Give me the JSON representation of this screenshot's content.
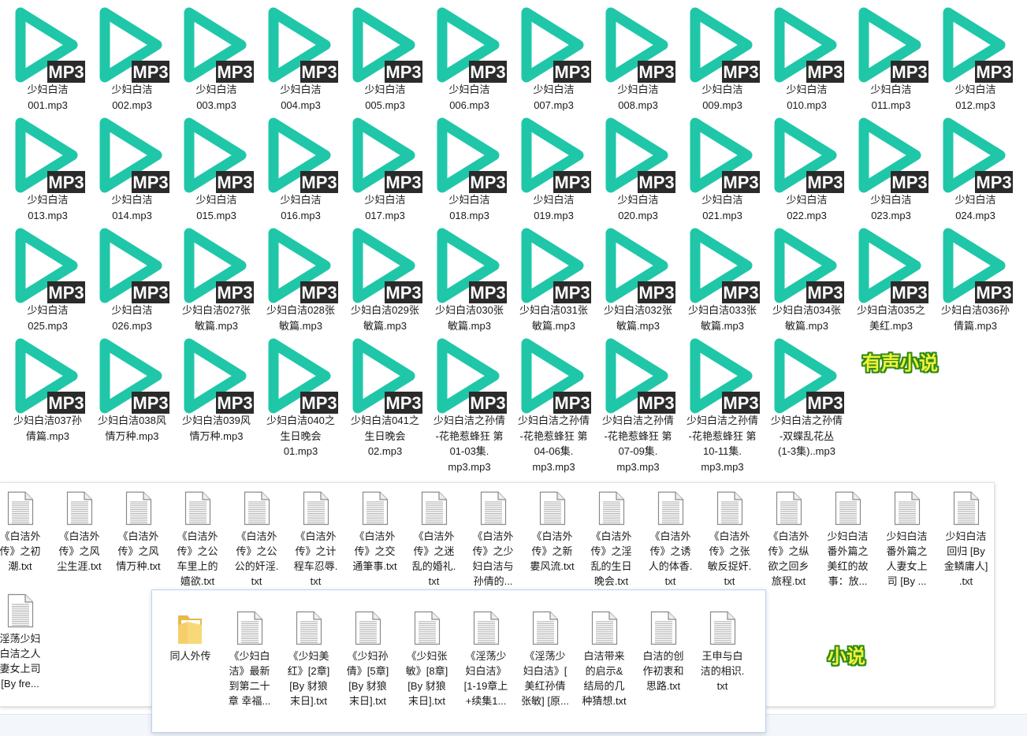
{
  "mp3_badge": "MP3",
  "colors": {
    "play": "#1fc7a8",
    "badge_bg": "#2b2b2b",
    "badge_fg": "#ffffff",
    "label_fill": "#f2f23a",
    "label_stroke": "#2f8a17"
  },
  "mp3_files": [
    "少妇白洁\n001.mp3",
    "少妇白洁\n002.mp3",
    "少妇白洁\n003.mp3",
    "少妇白洁\n004.mp3",
    "少妇白洁\n005.mp3",
    "少妇白洁\n006.mp3",
    "少妇白洁\n007.mp3",
    "少妇白洁\n008.mp3",
    "少妇白洁\n009.mp3",
    "少妇白洁\n010.mp3",
    "少妇白洁\n011.mp3",
    "少妇白洁\n012.mp3",
    "少妇白洁\n013.mp3",
    "少妇白洁\n014.mp3",
    "少妇白洁\n015.mp3",
    "少妇白洁\n016.mp3",
    "少妇白洁\n017.mp3",
    "少妇白洁\n018.mp3",
    "少妇白洁\n019.mp3",
    "少妇白洁\n020.mp3",
    "少妇白洁\n021.mp3",
    "少妇白洁\n022.mp3",
    "少妇白洁\n023.mp3",
    "少妇白洁\n024.mp3",
    "少妇白洁\n025.mp3",
    "少妇白洁\n026.mp3",
    "少妇白洁027张\n敏篇.mp3",
    "少妇白洁028张\n敏篇.mp3",
    "少妇白洁029张\n敏篇.mp3",
    "少妇白洁030张\n敏篇.mp3",
    "少妇白洁031张\n敏篇.mp3",
    "少妇白洁032张\n敏篇.mp3",
    "少妇白洁033张\n敏篇.mp3",
    "少妇白洁034张\n敏篇.mp3",
    "少妇白洁035之\n美红.mp3",
    "少妇白洁036孙\n倩篇.mp3",
    "少妇白洁037孙\n倩篇.mp3",
    "少妇白洁038风\n情万种.mp3",
    "少妇白洁039风\n情万种.mp3",
    "少妇白洁040之\n生日晚会\n01.mp3",
    "少妇白洁041之\n生日晚会\n02.mp3",
    "少妇白洁之孙倩\n-花艳惹蜂狂 第\n01-03集.\nmp3.mp3",
    "少妇白洁之孙倩\n-花艳惹蜂狂 第\n04-06集.\nmp3.mp3",
    "少妇白洁之孙倩\n-花艳惹蜂狂 第\n07-09集.\nmp3.mp3",
    "少妇白洁之孙倩\n-花艳惹蜂狂 第\n10-11集.\nmp3.mp3",
    "少妇白洁之孙倩\n-双蝶乱花丛\n(1-3集)..mp3"
  ],
  "txt_files": [
    "《白洁外\n传》之初\n潮.txt",
    "《白洁外\n传》之风\n尘生涯.txt",
    "《白洁外\n传》之风\n情万种.txt",
    "《白洁外\n传》之公\n车里上的\n嬉欲.txt",
    "《白洁外\n传》之公\n公的奸淫.\ntxt",
    "《白洁外\n传》之计\n程车忍辱.\ntxt",
    "《白洁外\n传》之交\n通筆事.txt",
    "《白洁外\n传》之迷\n乱的婚礼.\ntxt",
    "《白洁外\n传》之少\n妇白洁与\n孙倩的...",
    "《白洁外\n传》之新\n婁风流.txt",
    "《白洁外\n传》之淫\n乱的生日\n晚会.txt",
    "《白洁外\n传》之诱\n人的体香.\ntxt",
    "《白洁外\n传》之张\n敏反捉奸.\ntxt",
    "《白洁外\n传》之纵\n欲之回乡\n旅程.txt",
    "少妇白洁\n番外篇之\n美红的故\n事：放...",
    "少妇白洁\n番外篇之\n人妻女上\n司 [By ...",
    "少妇白洁\n回归 [By\n金鳞庸人]\n.txt",
    "淫荡少妇\n白洁之人\n妻女上司\n[By fre..."
  ],
  "sub_files": [
    "同人外传",
    "《少妇白\n洁》最新\n到第二十\n章 幸福...",
    "《少妇美\n红》[2章]\n[By 豺狼\n末日].txt",
    "《少妇孙\n倩》[5章]\n[By 豺狼\n末日].txt",
    "《少妇张\n敏》[8章]\n[By 豺狼\n末日].txt",
    "《淫荡少\n妇白洁》\n[1-19章上\n+续集1...",
    "《淫荡少\n妇白洁》[\n美红孙倩\n张敏] [原...",
    "白洁带来\n的启示&\n结局的几\n种猜想.txt",
    "白洁的创\n作初衷和\n思路.txt",
    "王申与白\n洁的相识.\ntxt"
  ],
  "labels": {
    "audio_novel": "有声小说",
    "novel": "小说"
  }
}
